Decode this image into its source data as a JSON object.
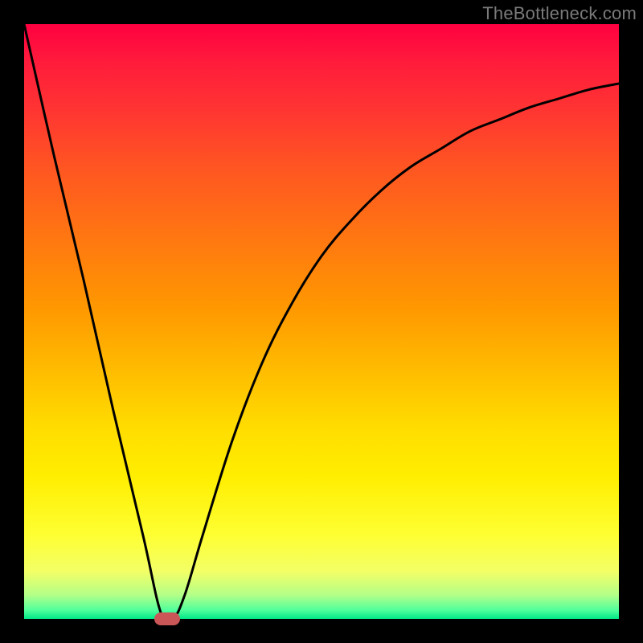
{
  "watermark": "TheBottleneck.com",
  "colors": {
    "top": "#ff0040",
    "bottom": "#00e887",
    "curve": "#000000",
    "marker": "#cb5658",
    "frame": "#000000"
  },
  "chart_data": {
    "type": "line",
    "title": "",
    "xlabel": "",
    "ylabel": "",
    "xlim": [
      0,
      100
    ],
    "ylim": [
      0,
      100
    ],
    "grid": false,
    "legend": false,
    "series": [
      {
        "name": "bottleneck-curve",
        "x": [
          0,
          5,
          10,
          15,
          20,
          23,
          25,
          27,
          30,
          35,
          40,
          45,
          50,
          55,
          60,
          65,
          70,
          75,
          80,
          85,
          90,
          95,
          100
        ],
        "y": [
          100,
          78,
          57,
          35,
          14,
          1,
          0,
          4,
          14,
          30,
          43,
          53,
          61,
          67,
          72,
          76,
          79,
          82,
          84,
          86,
          87.5,
          89,
          90
        ]
      }
    ],
    "marker": {
      "x": 24,
      "y": 0
    },
    "background_gradient": "vertical red→orange→yellow→green"
  }
}
